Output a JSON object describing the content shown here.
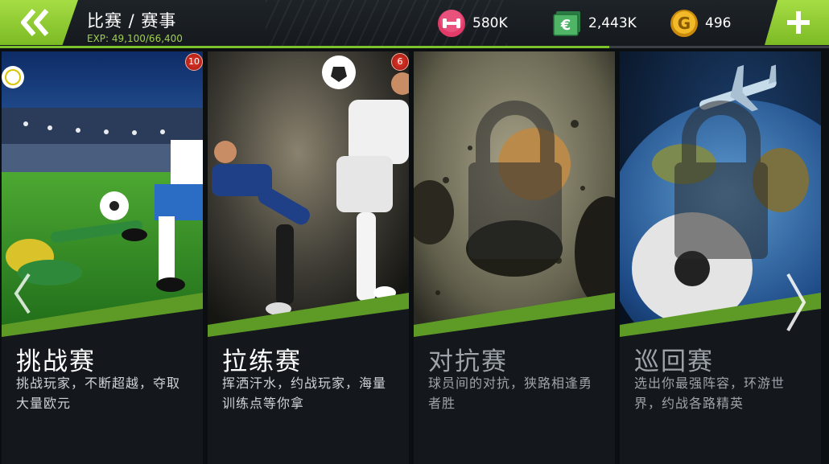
{
  "header": {
    "title": "比赛 / 赛事",
    "exp": "EXP: 49,100/66,400",
    "exp_progress": 0.739
  },
  "currencies": [
    {
      "icon": "dumbbell-icon",
      "value": "580K",
      "color": "#e23b6a"
    },
    {
      "icon": "euro-banknote-icon",
      "value": "2,443K",
      "color": "#3aa55a"
    },
    {
      "icon": "gold-coin-icon",
      "value": "496",
      "color": "#e0a418",
      "symbol": "G"
    }
  ],
  "cards": [
    {
      "title": "挑战赛",
      "desc": "挑战玩家，不断超越，夺取大量欧元",
      "badge": "10",
      "locked": false
    },
    {
      "title": "拉练赛",
      "desc": "挥洒汗水，约战玩家，海量训练点等你拿",
      "badge": "6",
      "locked": false
    },
    {
      "title": "对抗赛",
      "desc": "球员间的对抗，狭路相逢勇者胜",
      "badge": "",
      "locked": true
    },
    {
      "title": "巡回赛",
      "desc": "选出你最强阵容，环游世界，约战各路精英",
      "badge": "",
      "locked": true
    }
  ],
  "colors": {
    "accent": "#8cc63f",
    "badge": "#d42a1e"
  }
}
